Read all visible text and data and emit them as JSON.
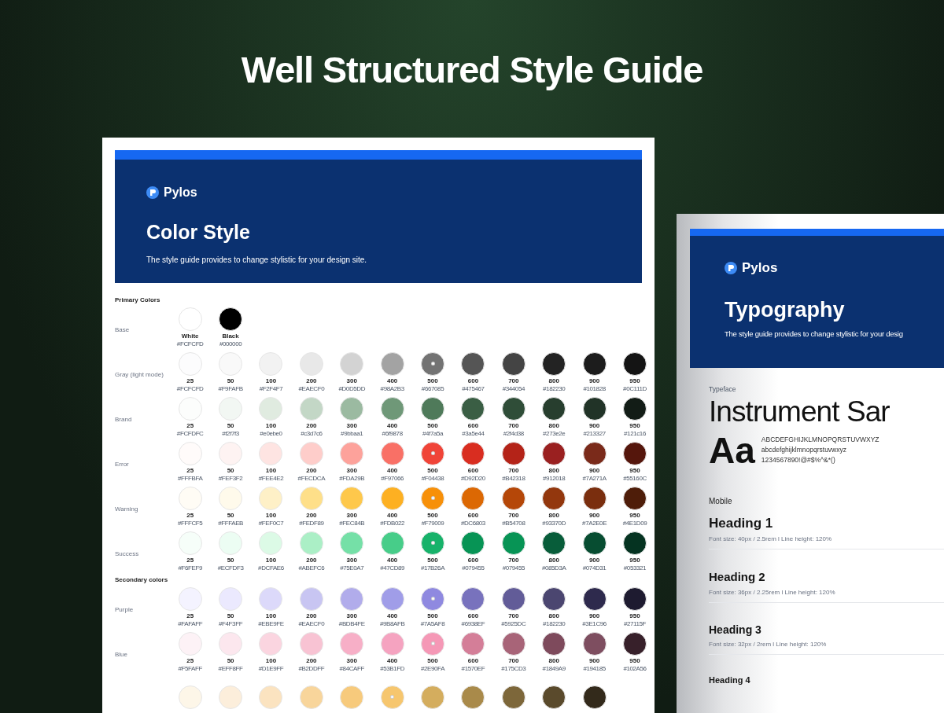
{
  "headline": "Well Structured Style Guide",
  "color_style": {
    "logo": "Pylos",
    "title": "Color Style",
    "subtitle": "The style guide provides to change stylistic for your design site.",
    "groups": [
      {
        "heading": "Primary Colors",
        "rows": [
          {
            "label": "Base",
            "swatches": [
              {
                "step": "White",
                "hex": "#FCFCFD",
                "color": "#ffffff",
                "dot": false
              },
              {
                "step": "Black",
                "hex": "#000000",
                "color": "#000000",
                "dot": false
              }
            ]
          },
          {
            "label": "Gray (light mode)",
            "swatches": [
              {
                "step": "25",
                "hex": "#FCFCFD",
                "color": "#fcfcfd",
                "dot": false
              },
              {
                "step": "50",
                "hex": "#F9FAFB",
                "color": "#f9f9f9",
                "dot": false
              },
              {
                "step": "100",
                "hex": "#F2F4F7",
                "color": "#f2f2f2",
                "dot": false
              },
              {
                "step": "200",
                "hex": "#EAECF0",
                "color": "#e8e8e8",
                "dot": false
              },
              {
                "step": "300",
                "hex": "#D0D5DD",
                "color": "#d3d3d3",
                "dot": false
              },
              {
                "step": "400",
                "hex": "#98A2B3",
                "color": "#a3a3a3",
                "dot": false
              },
              {
                "step": "500",
                "hex": "#667085",
                "color": "#737373",
                "dot": true
              },
              {
                "step": "600",
                "hex": "#475467",
                "color": "#555555",
                "dot": false
              },
              {
                "step": "700",
                "hex": "#344054",
                "color": "#444444",
                "dot": false
              },
              {
                "step": "800",
                "hex": "#182230",
                "color": "#232323",
                "dot": false
              },
              {
                "step": "900",
                "hex": "#101828",
                "color": "#1c1c1c",
                "dot": false
              },
              {
                "step": "950",
                "hex": "#0C111D",
                "color": "#141414",
                "dot": false
              }
            ]
          },
          {
            "label": "Brand",
            "swatches": [
              {
                "step": "25",
                "hex": "#FCFDFC",
                "color": "#fcfdfc",
                "dot": false
              },
              {
                "step": "50",
                "hex": "#f2f7f3",
                "color": "#f2f7f3",
                "dot": false
              },
              {
                "step": "100",
                "hex": "#e0ebe0",
                "color": "#e0ebe0",
                "dot": false
              },
              {
                "step": "200",
                "hex": "#c3d7c6",
                "color": "#c3d7c6",
                "dot": false
              },
              {
                "step": "300",
                "hex": "#9bbaa1",
                "color": "#9bbaa1",
                "dot": false
              },
              {
                "step": "400",
                "hex": "#6f9878",
                "color": "#6f9878",
                "dot": false
              },
              {
                "step": "500",
                "hex": "#4f7a5a",
                "color": "#4f7a5a",
                "dot": false
              },
              {
                "step": "600",
                "hex": "#3a5e44",
                "color": "#3a5e44",
                "dot": false
              },
              {
                "step": "700",
                "hex": "#2f4d38",
                "color": "#2f4d38",
                "dot": false
              },
              {
                "step": "800",
                "hex": "#273e2e",
                "color": "#273e2e",
                "dot": false
              },
              {
                "step": "900",
                "hex": "#213327",
                "color": "#213327",
                "dot": false
              },
              {
                "step": "950",
                "hex": "#121c16",
                "color": "#121c16",
                "dot": false
              }
            ]
          },
          {
            "label": "Error",
            "swatches": [
              {
                "step": "25",
                "hex": "#FFFBFA",
                "color": "#fffbfa",
                "dot": false
              },
              {
                "step": "50",
                "hex": "#FEF3F2",
                "color": "#fef3f2",
                "dot": false
              },
              {
                "step": "100",
                "hex": "#FEE4E2",
                "color": "#fee4e2",
                "dot": false
              },
              {
                "step": "200",
                "hex": "#FECDCA",
                "color": "#fecdca",
                "dot": false
              },
              {
                "step": "300",
                "hex": "#FDA29B",
                "color": "#fda29b",
                "dot": false
              },
              {
                "step": "400",
                "hex": "#F97066",
                "color": "#f97066",
                "dot": false
              },
              {
                "step": "500",
                "hex": "#F04438",
                "color": "#f04438",
                "dot": true
              },
              {
                "step": "600",
                "hex": "#D92D20",
                "color": "#d92d20",
                "dot": false
              },
              {
                "step": "700",
                "hex": "#B42318",
                "color": "#b42318",
                "dot": false
              },
              {
                "step": "800",
                "hex": "#912018",
                "color": "#9a2020",
                "dot": false
              },
              {
                "step": "900",
                "hex": "#7A271A",
                "color": "#7a2a1a",
                "dot": false
              },
              {
                "step": "950",
                "hex": "#55160C",
                "color": "#55160c",
                "dot": false
              }
            ]
          },
          {
            "label": "Warning",
            "swatches": [
              {
                "step": "25",
                "hex": "#FFFCF5",
                "color": "#fffcf5",
                "dot": false
              },
              {
                "step": "50",
                "hex": "#FFFAEB",
                "color": "#fffaeb",
                "dot": false
              },
              {
                "step": "100",
                "hex": "#FEF0C7",
                "color": "#fef0c7",
                "dot": false
              },
              {
                "step": "200",
                "hex": "#FEDF89",
                "color": "#fedf89",
                "dot": false
              },
              {
                "step": "300",
                "hex": "#FEC84B",
                "color": "#fec84b",
                "dot": false
              },
              {
                "step": "400",
                "hex": "#FDB022",
                "color": "#fdb022",
                "dot": false
              },
              {
                "step": "500",
                "hex": "#F79009",
                "color": "#f79009",
                "dot": true
              },
              {
                "step": "600",
                "hex": "#DC6803",
                "color": "#dc6803",
                "dot": false
              },
              {
                "step": "700",
                "hex": "#B54708",
                "color": "#b54708",
                "dot": false
              },
              {
                "step": "800",
                "hex": "#93370D",
                "color": "#93370d",
                "dot": false
              },
              {
                "step": "900",
                "hex": "#7A2E0E",
                "color": "#7a2e0e",
                "dot": false
              },
              {
                "step": "950",
                "hex": "#4E1D09",
                "color": "#4e1d09",
                "dot": false
              }
            ]
          },
          {
            "label": "Success",
            "swatches": [
              {
                "step": "25",
                "hex": "#F6FEF9",
                "color": "#f6fef9",
                "dot": false
              },
              {
                "step": "50",
                "hex": "#ECFDF3",
                "color": "#ecfdf3",
                "dot": false
              },
              {
                "step": "100",
                "hex": "#DCFAE6",
                "color": "#dcfae6",
                "dot": false
              },
              {
                "step": "200",
                "hex": "#ABEFC6",
                "color": "#abefc6",
                "dot": false
              },
              {
                "step": "300",
                "hex": "#75E0A7",
                "color": "#75e0a7",
                "dot": false
              },
              {
                "step": "400",
                "hex": "#47CD89",
                "color": "#47cd89",
                "dot": false
              },
              {
                "step": "500",
                "hex": "#17B26A",
                "color": "#17b26a",
                "dot": true
              },
              {
                "step": "600",
                "hex": "#079455",
                "color": "#079455",
                "dot": false
              },
              {
                "step": "700",
                "hex": "#079455",
                "color": "#079455",
                "dot": false
              },
              {
                "step": "800",
                "hex": "#085D3A",
                "color": "#085d3a",
                "dot": false
              },
              {
                "step": "900",
                "hex": "#074D31",
                "color": "#074d31",
                "dot": false
              },
              {
                "step": "950",
                "hex": "#053321",
                "color": "#053321",
                "dot": false
              }
            ]
          }
        ]
      },
      {
        "heading": "Secondary colors",
        "rows": [
          {
            "label": "Purple",
            "swatches": [
              {
                "step": "25",
                "hex": "#FAFAFF",
                "color": "#f4f3ff",
                "dot": false
              },
              {
                "step": "50",
                "hex": "#F4F3FF",
                "color": "#ebe9fe",
                "dot": false
              },
              {
                "step": "100",
                "hex": "#EBE9FE",
                "color": "#dcd9fa",
                "dot": false
              },
              {
                "step": "200",
                "hex": "#EAECF0",
                "color": "#c8c5f2",
                "dot": false
              },
              {
                "step": "300",
                "hex": "#BDB4FE",
                "color": "#b1aceb",
                "dot": false
              },
              {
                "step": "400",
                "hex": "#9B8AFB",
                "color": "#a09de8",
                "dot": false
              },
              {
                "step": "500",
                "hex": "#7A5AF8",
                "color": "#8f89e0",
                "dot": true
              },
              {
                "step": "600",
                "hex": "#6938EF",
                "color": "#7872bd",
                "dot": false
              },
              {
                "step": "700",
                "hex": "#5925DC",
                "color": "#625c98",
                "dot": false
              },
              {
                "step": "800",
                "hex": "#182230",
                "color": "#4b4670",
                "dot": false
              },
              {
                "step": "900",
                "hex": "#3E1C96",
                "color": "#2e2a4d",
                "dot": false
              },
              {
                "step": "950",
                "hex": "#27115F",
                "color": "#1e1b30",
                "dot": false
              }
            ]
          },
          {
            "label": "Blue",
            "swatches": [
              {
                "step": "25",
                "hex": "#F5FAFF",
                "color": "#fdf2f6",
                "dot": false
              },
              {
                "step": "50",
                "hex": "#EFF8FF",
                "color": "#fce7ee",
                "dot": false
              },
              {
                "step": "100",
                "hex": "#D1E9FF",
                "color": "#fbd5e0",
                "dot": false
              },
              {
                "step": "200",
                "hex": "#B2DDFF",
                "color": "#f8c3d3",
                "dot": false
              },
              {
                "step": "300",
                "hex": "#84CAFF",
                "color": "#f7afc7",
                "dot": false
              },
              {
                "step": "400",
                "hex": "#53B1FD",
                "color": "#f5a3c0",
                "dot": false
              },
              {
                "step": "500",
                "hex": "#2E90FA",
                "color": "#f598b6",
                "dot": true
              },
              {
                "step": "600",
                "hex": "#1570EF",
                "color": "#d47e98",
                "dot": false
              },
              {
                "step": "700",
                "hex": "#175CD3",
                "color": "#a86478",
                "dot": false
              },
              {
                "step": "800",
                "hex": "#1849A9",
                "color": "#7e4a5c",
                "dot": false
              },
              {
                "step": "900",
                "hex": "#194185",
                "color": "#7e4e60",
                "dot": false
              },
              {
                "step": "950",
                "hex": "#102A56",
                "color": "#37202a",
                "dot": false
              }
            ]
          },
          {
            "swatches": [
              {
                "color": "#fdf6e8",
                "dot": false
              },
              {
                "color": "#fceedb",
                "dot": false
              },
              {
                "color": "#fbe3c0",
                "dot": false
              },
              {
                "color": "#f8d59b",
                "dot": false
              },
              {
                "color": "#f7ca7c",
                "dot": false
              },
              {
                "color": "#f6c66e",
                "dot": true
              },
              {
                "color": "#d4ad5e",
                "dot": false
              },
              {
                "color": "#a98a4a",
                "dot": false
              },
              {
                "color": "#7d673a",
                "dot": false
              },
              {
                "color": "#5a4a2c",
                "dot": false
              },
              {
                "color": "#332a1b",
                "dot": false
              }
            ]
          }
        ]
      }
    ]
  },
  "typography": {
    "logo": "Pylos",
    "title": "Typography",
    "subtitle": "The style guide provides to change stylistic for your desig",
    "typeface_label": "Typeface",
    "typeface_name": "Instrument Sar",
    "sample": "Aa",
    "charset": [
      "ABCDEFGHIJKLMNOPQRSTUVWXYZ",
      "abcdefghijklmnopqrstuvwxyz",
      "1234567890!@#$%^&*()"
    ],
    "section": "Mobile",
    "headings": [
      {
        "name": "Heading 1",
        "spec": "Font size: 40px / 2.5rem l Line height: 120%"
      },
      {
        "name": "Heading 2",
        "spec": "Font size: 36px / 2.25rem l Line height: 120%"
      },
      {
        "name": "Heading 3",
        "spec": "Font size: 32px / 2rem l Line height: 120%"
      },
      {
        "name": "Heading 4"
      }
    ]
  }
}
